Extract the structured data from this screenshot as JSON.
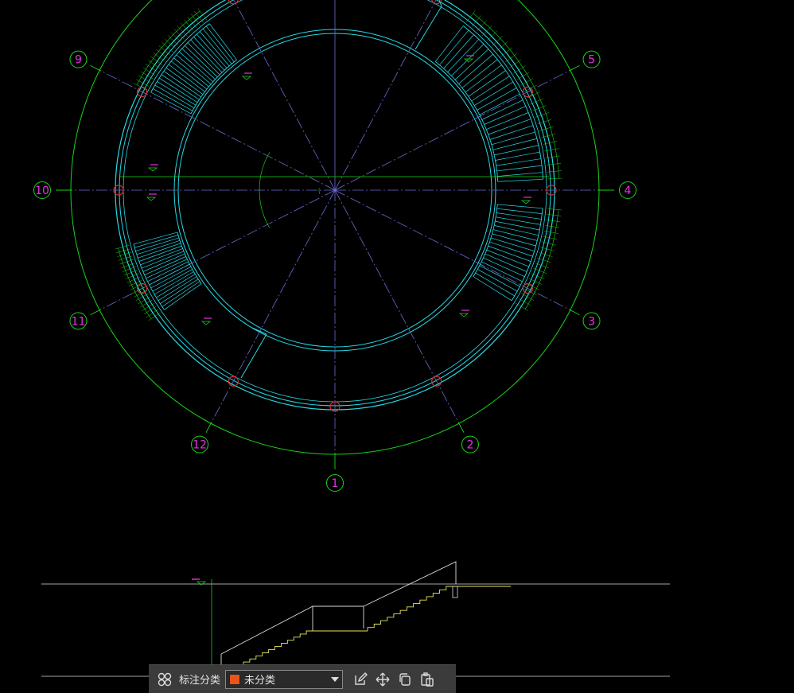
{
  "plan": {
    "axis_labels": [
      "1",
      "2",
      "3",
      "4",
      "5",
      "9",
      "10",
      "11",
      "12"
    ]
  },
  "toolbar": {
    "category_label": "标注分类",
    "category_value": "未分类",
    "category_color": "#e8551b",
    "icons": [
      "group-icon",
      "edit-icon",
      "move-icon",
      "copy-icon",
      "paste-icon"
    ]
  },
  "colors": {
    "background": "#000000",
    "axis_green": "#19d419",
    "wall_cyan": "#26d9e6",
    "axis_purple": "#6b6bd6",
    "label_magenta": "#e033e0",
    "section_yellow": "#e6e65c",
    "section_white": "#dcdcdc",
    "marker_red": "#d9302a"
  }
}
